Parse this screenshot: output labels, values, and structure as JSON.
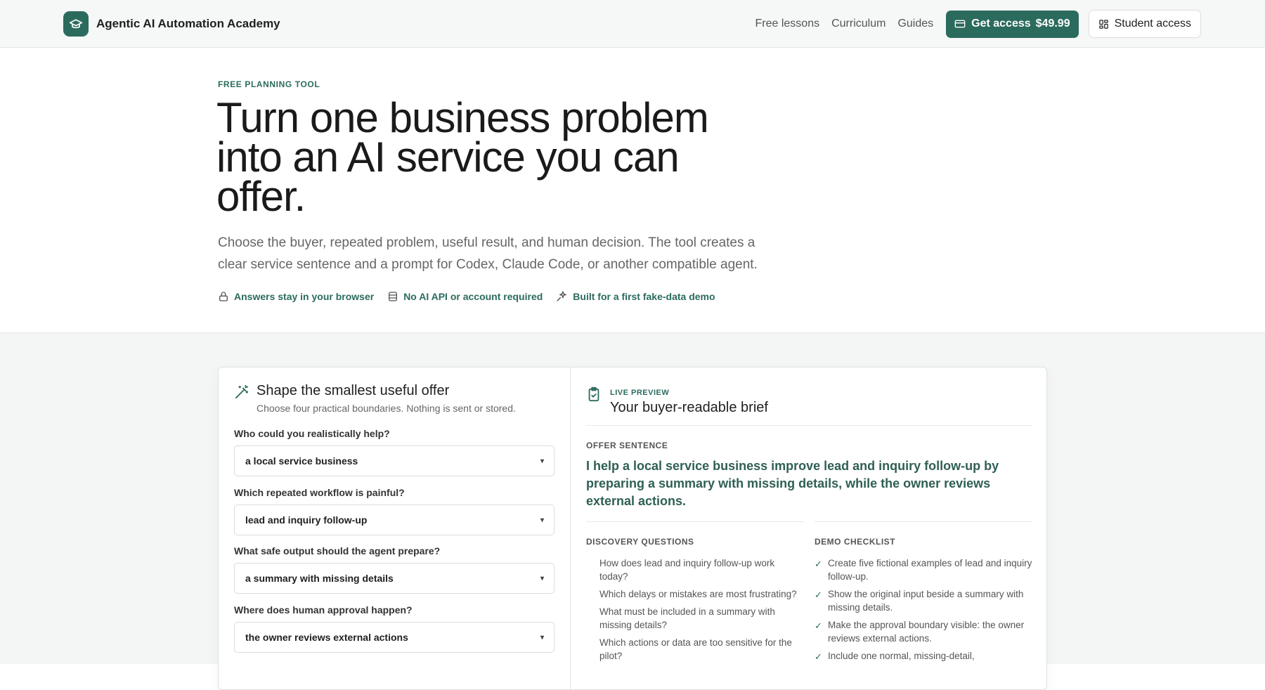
{
  "header": {
    "brand_name": "Agentic AI Automation Academy",
    "nav_links": [
      "Free lessons",
      "Curriculum",
      "Guides"
    ],
    "cta_label": "Get access",
    "cta_price": "$49.99",
    "student_label": "Student access"
  },
  "hero": {
    "eyebrow": "FREE PLANNING TOOL",
    "title": "Turn one business problem into an AI service you can offer.",
    "description": "Choose the buyer, repeated problem, useful result, and human decision. The tool creates a clear service sentence and a prompt for Codex, Claude Code, or another compatible agent.",
    "badges": [
      {
        "icon": "lock-icon",
        "label": "Answers stay in your browser"
      },
      {
        "icon": "database-icon",
        "label": "No AI API or account required"
      },
      {
        "icon": "sparkle-icon",
        "label": "Built for a first fake-data demo"
      }
    ]
  },
  "form": {
    "title": "Shape the smallest useful offer",
    "subtitle": "Choose four practical boundaries. Nothing is sent or stored.",
    "fields": [
      {
        "label": "Who could you realistically help?",
        "value": "a local service business"
      },
      {
        "label": "Which repeated workflow is painful?",
        "value": "lead and inquiry follow-up"
      },
      {
        "label": "What safe output should the agent prepare?",
        "value": "a summary with missing details"
      },
      {
        "label": "Where does human approval happen?",
        "value": "the owner reviews external actions"
      }
    ]
  },
  "preview": {
    "live_label": "LIVE PREVIEW",
    "title": "Your buyer-readable brief",
    "offer_label": "OFFER SENTENCE",
    "offer_text": "I help a local service business improve lead and inquiry follow-up by preparing a summary with missing details, while the owner reviews external actions.",
    "discovery_label": "DISCOVERY QUESTIONS",
    "discovery_questions": [
      "How does lead and inquiry follow-up work today?",
      "Which delays or mistakes are most frustrating?",
      "What must be included in a summary with missing details?",
      "Which actions or data are too sensitive for the pilot?"
    ],
    "checklist_label": "DEMO CHECKLIST",
    "checklist": [
      "Create five fictional examples of lead and inquiry follow-up.",
      "Show the original input beside a summary with missing details.",
      "Make the approval boundary visible: the owner reviews external actions.",
      "Include one normal, missing-detail,"
    ]
  },
  "colors": {
    "accent": "#2b6b5d",
    "accent_text": "#2f5f55",
    "page_bg": "#f4f5f5"
  }
}
